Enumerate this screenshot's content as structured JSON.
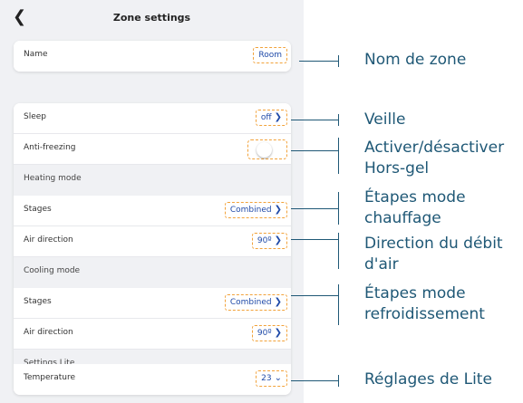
{
  "header": {
    "title": "Zone settings",
    "back_icon": "chevron-left-icon"
  },
  "name_card": {
    "label": "Name",
    "value": "Room"
  },
  "settings": {
    "sleep": {
      "label": "Sleep",
      "value": "off"
    },
    "anti_freezing": {
      "label": "Anti-freezing",
      "enabled": false
    },
    "heating_section": "Heating mode",
    "heating_stages": {
      "label": "Stages",
      "value": "Combined"
    },
    "heating_air_direction": {
      "label": "Air direction",
      "value": "90º"
    },
    "cooling_section": "Cooling mode",
    "cooling_stages": {
      "label": "Stages",
      "value": "Combined"
    },
    "cooling_air_direction": {
      "label": "Air direction",
      "value": "90º"
    },
    "lite_section": "Settings Lite",
    "temperature": {
      "label": "Temperature",
      "value": "23"
    }
  },
  "annotations": {
    "name": "Nom de zone",
    "sleep": "Veille",
    "anti_freezing": "Activer/désactiver Hors-gel",
    "heating_stages": "Étapes mode chauffage",
    "air_direction": "Direction du débit d'air",
    "cooling_stages": "Étapes mode refroidissement",
    "lite": "Réglages de Lite"
  },
  "colors": {
    "accent_dashed": "#f2a23a",
    "value_text": "#1f4aa8",
    "annotation": "#1f5876",
    "background": "#f0f1f4"
  }
}
